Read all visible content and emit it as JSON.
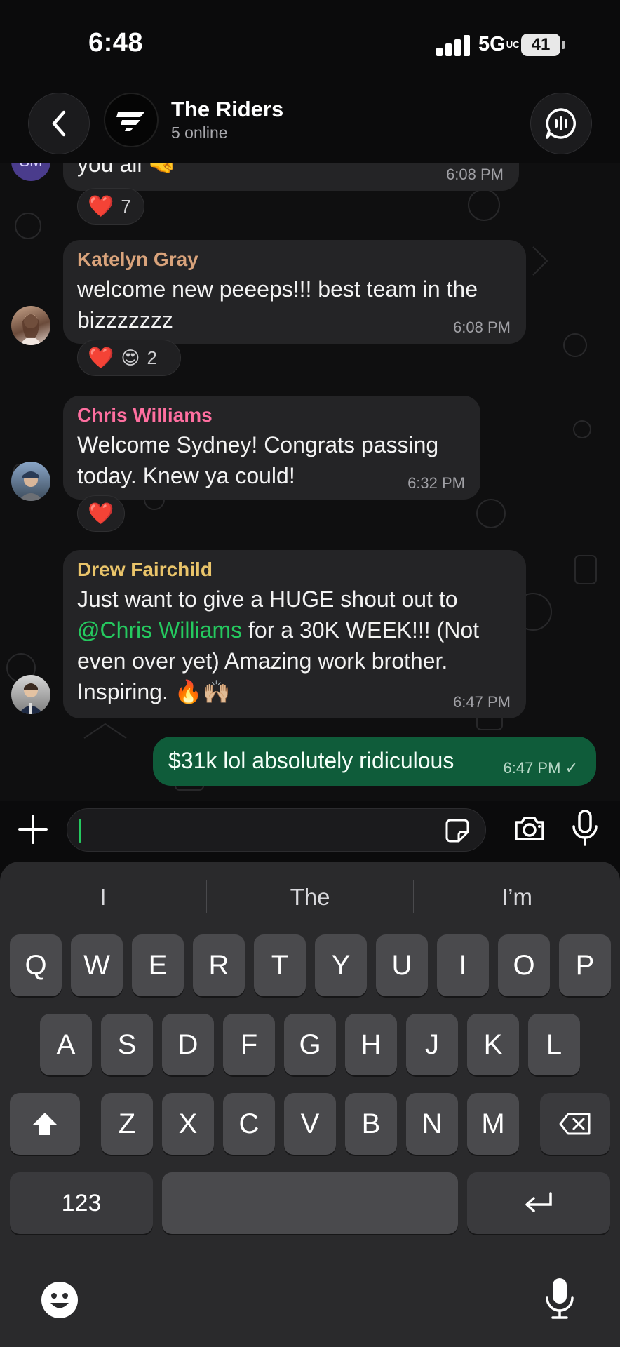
{
  "status": {
    "time": "6:48",
    "network": "5G",
    "network_sup": "UC",
    "battery": "41"
  },
  "header": {
    "title": "The Riders",
    "subtitle": "5 online"
  },
  "messages": [
    {
      "text": "you all 🤜",
      "time": "6:08 PM",
      "avatar_initials": "SM",
      "reactions": [
        "❤️"
      ],
      "reaction_count": "7"
    },
    {
      "sender": "Katelyn Gray",
      "sender_color": "#d9a37b",
      "lines": [
        "welcome new peeeps!!! best team in the",
        "bizzzzzzz"
      ],
      "time": "6:08 PM",
      "reactions": [
        "❤️",
        "😍"
      ],
      "reaction_count": "2"
    },
    {
      "sender": "Chris Williams",
      "sender_color": "#ff6fa0",
      "lines": [
        "Welcome Sydney! Congrats passing",
        "today. Knew ya could!"
      ],
      "time": "6:32 PM",
      "reactions": [
        "❤️"
      ]
    },
    {
      "sender": "Drew Fairchild",
      "sender_color": "#e9c46a",
      "text_before": "Just want to give a HUGE shout out to",
      "mention": "@Chris Williams",
      "text_after": " for a 30K WEEK!!! (Not",
      "line3": "even over yet) Amazing work brother.",
      "line4": "Inspiring. 🔥🙌🏼",
      "time": "6:47 PM"
    },
    {
      "own": true,
      "text": "$31k lol absolutely ridiculous",
      "time": "6:47 PM",
      "check": "✓"
    }
  ],
  "suggestions": [
    "I",
    "The",
    "I’m"
  ],
  "keys": {
    "row1": [
      "Q",
      "W",
      "E",
      "R",
      "T",
      "Y",
      "U",
      "I",
      "O",
      "P"
    ],
    "row2": [
      "A",
      "S",
      "D",
      "F",
      "G",
      "H",
      "J",
      "K",
      "L"
    ],
    "row3": [
      "Z",
      "X",
      "C",
      "V",
      "B",
      "N",
      "M"
    ],
    "numbers": "123"
  },
  "icons": [
    "back-icon",
    "group-logo-icon",
    "call-icon",
    "plus-icon",
    "sticker-icon",
    "camera-icon",
    "mic-icon",
    "shift-icon",
    "backspace-icon",
    "return-icon",
    "emoji-icon",
    "dictation-icon"
  ]
}
